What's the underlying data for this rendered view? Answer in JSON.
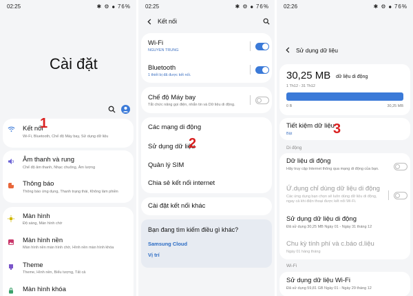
{
  "p1": {
    "status_time": "02:25",
    "status_right": "✱ ⚙ ⦁ 76%",
    "title": "Cài đặt",
    "items": [
      {
        "label": "Kết nối",
        "sub": "Wi-Fi, Bluetooth, Chế độ Máy bay, Sử dụng dữ liệu"
      },
      {
        "label": "Âm thanh và rung",
        "sub": "Chế độ âm thanh, Nhạc chuông, Âm lượng"
      },
      {
        "label": "Thông báo",
        "sub": "Thông báo ứng dụng, Thanh trạng thái, Không làm phiền"
      },
      {
        "label": "Màn hình",
        "sub": "Độ sáng, Màn hình chờ"
      },
      {
        "label": "Màn hình nền",
        "sub": "Màn hình nền màn hình chờ, Hình nền màn hình khóa"
      },
      {
        "label": "Theme",
        "sub": "Theme, Hình nền, Biểu tượng, Tất cả"
      },
      {
        "label": "Màn hình khóa",
        "sub": ""
      }
    ],
    "step": "1",
    "colors": {
      "accent": "#3b7ad8",
      "step": "#d91f1f"
    }
  },
  "p2": {
    "status_time": "02:25",
    "status_right": "✱ ⚙ ⦁ 76%",
    "header": "Kết nối",
    "wifi": {
      "label": "Wi-Fi",
      "sub": "NGUYEN TRUNG"
    },
    "bluetooth": {
      "label": "Bluetooth",
      "sub": "1 thiết bị đã được kết nối."
    },
    "airplane": {
      "label": "Chế độ Máy bay",
      "sub": "Tắt chức năng gọi điện, nhắn tin và Dữ liệu di động."
    },
    "items": [
      "Các mạng di động",
      "Sử dụng dữ liệu",
      "Quản lý SIM",
      "Chia sẻ kết nối internet"
    ],
    "more": "Cài đặt kết nối khác",
    "search_title": "Bạn đang tìm kiếm điều gì khác?",
    "link1": "Samsung Cloud",
    "link2": "Vị trí",
    "step": "2"
  },
  "p3": {
    "status_time": "02:26",
    "status_right": "✱ ⚙ ⦁ 76%",
    "header": "Sử dụng dữ liệu",
    "amount": "30,25 MB",
    "amount_label": "dữ liệu di động",
    "range": "1 Th12 - 31 Th12",
    "bar_min": "0 B",
    "bar_max": "30,25 MB",
    "saver": {
      "label": "Tiết kiệm dữ liệu",
      "sub": "Bật"
    },
    "section_mobile": "Di động",
    "mobile_data": {
      "label": "Dữ liệu di động",
      "sub": "Hãy truy cập Internet thông qua mạng di động của bạn."
    },
    "apps_only": {
      "label": "Ứ.dụng chỉ dùng dữ liệu di động",
      "sub": "Các ứng dụng bạn chọn sẽ luôn dùng dữ liệu di động, ngay cả khi điện thoại được kết nối Wi-Fi."
    },
    "usage": {
      "label": "Sử dụng dữ liệu di động",
      "sub": "Đã sử dụng 30,25 MB Ngày 01 - Ngày 31 tháng 12"
    },
    "cycle": {
      "label": "Chu kỳ tính phí và c.báo d.liệu",
      "sub": "Ngày 01 hàng tháng"
    },
    "section_wifi": "Wi-Fi",
    "wifi_usage": {
      "label": "Sử dụng dữ liệu Wi-Fi",
      "sub": "Đã sử dụng 59,81 GB Ngày 01 - Ngày 29 tháng 12"
    },
    "step": "3"
  }
}
